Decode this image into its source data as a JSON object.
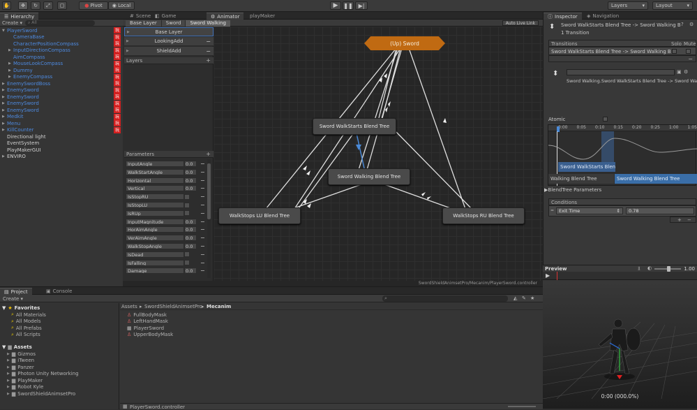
{
  "toolbar": {
    "pivot": "Pivot",
    "local": "Local",
    "layers": "Layers",
    "layout": "Layout"
  },
  "hierarchy": {
    "tab": "Hierarchy",
    "create": "Create",
    "search_placeholder": "All",
    "items": [
      {
        "label": "PlayerSword",
        "depth": 0,
        "color": "blue",
        "arrow": "▼",
        "tag": true
      },
      {
        "label": "CameraBase",
        "depth": 1,
        "color": "blue",
        "arrow": "",
        "tag": true
      },
      {
        "label": "CharacterPositionCompass",
        "depth": 1,
        "color": "blue",
        "arrow": "",
        "tag": true
      },
      {
        "label": "InputDirectionCompass",
        "depth": 1,
        "color": "blue",
        "arrow": "▶",
        "tag": true
      },
      {
        "label": "AimCompass",
        "depth": 1,
        "color": "blue",
        "arrow": "",
        "tag": true
      },
      {
        "label": "MouseLookCompass",
        "depth": 1,
        "color": "blue",
        "arrow": "▶",
        "tag": true
      },
      {
        "label": "Dummy",
        "depth": 1,
        "color": "blue",
        "arrow": "▶",
        "tag": true
      },
      {
        "label": "EnemyCompass",
        "depth": 1,
        "color": "blue",
        "arrow": "▶",
        "tag": true
      },
      {
        "label": "EnemySwordBoss",
        "depth": 0,
        "color": "blue",
        "arrow": "▶",
        "tag": true
      },
      {
        "label": "EnemySword",
        "depth": 0,
        "color": "blue",
        "arrow": "▶",
        "tag": true
      },
      {
        "label": "EnemySword",
        "depth": 0,
        "color": "blue",
        "arrow": "▶",
        "tag": true
      },
      {
        "label": "EnemySword",
        "depth": 0,
        "color": "blue",
        "arrow": "▶",
        "tag": true
      },
      {
        "label": "EnemySword",
        "depth": 0,
        "color": "blue",
        "arrow": "▶",
        "tag": true
      },
      {
        "label": "Medkit",
        "depth": 0,
        "color": "blue",
        "arrow": "▶",
        "tag": true
      },
      {
        "label": "Menu",
        "depth": 0,
        "color": "blue",
        "arrow": "▶",
        "tag": true
      },
      {
        "label": "KillCounter",
        "depth": 0,
        "color": "blue",
        "arrow": "▶",
        "tag": true
      },
      {
        "label": "Directional light",
        "depth": 0,
        "color": "white",
        "arrow": "",
        "tag": false
      },
      {
        "label": "EventSystem",
        "depth": 0,
        "color": "white",
        "arrow": "",
        "tag": false
      },
      {
        "label": "PlayMakerGUI",
        "depth": 0,
        "color": "white",
        "arrow": "",
        "tag": false
      },
      {
        "label": "ENVIRO",
        "depth": 0,
        "color": "white",
        "arrow": "▶",
        "tag": false
      }
    ],
    "tag_glyph": "玩"
  },
  "center_tabs": {
    "scene": "Scene",
    "game": "Game",
    "animator": "Animator",
    "playmaker": "playMaker"
  },
  "animator": {
    "breadcrumb": [
      "Base Layer",
      "Sword",
      "Sword Walking"
    ],
    "auto_live_link": "Auto Live Link",
    "layers": [
      "Base Layer",
      "LookingAdd",
      "ShieldAdd"
    ],
    "layers_label": "Layers",
    "parameters_label": "Parameters",
    "parameters": [
      {
        "name": "InputAngle",
        "type": "float",
        "value": "0.0"
      },
      {
        "name": "WalkStartAngle",
        "type": "float",
        "value": "0.0"
      },
      {
        "name": "Horizontal",
        "type": "float",
        "value": "0.0"
      },
      {
        "name": "Vertical",
        "type": "float",
        "value": "0.0"
      },
      {
        "name": "IsStopRU",
        "type": "bool",
        "value": ""
      },
      {
        "name": "IsStopLU",
        "type": "bool",
        "value": ""
      },
      {
        "name": "IsRUp",
        "type": "bool",
        "value": ""
      },
      {
        "name": "InputMagnitude",
        "type": "float",
        "value": "0.0"
      },
      {
        "name": "HorAimAngle",
        "type": "float",
        "value": "0.0"
      },
      {
        "name": "VerAimAngle",
        "type": "float",
        "value": "0.0"
      },
      {
        "name": "WalkStopAngle",
        "type": "float",
        "value": "0.0"
      },
      {
        "name": "IsDead",
        "type": "bool",
        "value": ""
      },
      {
        "name": "IsFalling",
        "type": "bool",
        "value": ""
      },
      {
        "name": "Damage",
        "type": "float",
        "value": "0.0"
      }
    ],
    "nodes": {
      "up": "(Up) Sword",
      "walkstarts": "Sword WalkStarts Blend Tree",
      "walking": "Sword Walking Blend Tree",
      "stopslu": "WalkStops LU Blend Tree",
      "stopsru": "WalkStops RU Blend Tree"
    },
    "path": "SwordShieldAnimsetPro/Mecanim/PlayerSword.controller"
  },
  "inspector": {
    "tab": "Inspector",
    "nav_tab": "Navigation",
    "title": "Sword WalkStarts Blend Tree -> Sword Walking B",
    "transitions_count": "1 Transition",
    "transitions_label": "Transitions",
    "solo": "Solo",
    "mute": "Mute",
    "transition_item": "Sword WalkStarts Blend Tree -> Sword Walking B",
    "sub_title": "Sword Walking.Sword WalkStarts Blend Tree -> Sword Walking",
    "atomic": "Atomic",
    "timeline_ticks": [
      "0:00",
      "0:05",
      "0:10",
      "0:15",
      "0:20",
      "0:25",
      "1:00",
      "1:05"
    ],
    "bar_from": "Sword WalkStarts Blend",
    "bar_to_left": "Walking Blend Tree",
    "bar_to_right": "Sword Walking Blend Tree",
    "blend_params": "BlendTree Parameters",
    "conditions": "Conditions",
    "condition_name": "Exit Time",
    "condition_value": "0.78",
    "preview": "Preview",
    "preview_speed": "1.00",
    "preview_time": "0:00 (000.0%)"
  },
  "project": {
    "tab": "Project",
    "console_tab": "Console",
    "create": "Create",
    "favorites_label": "Favorites",
    "favorites": [
      "All Materials",
      "All Models",
      "All Prefabs",
      "All Scripts"
    ],
    "assets_label": "Assets",
    "folders": [
      "Gizmos",
      "iTween",
      "Panzer",
      "Photon Unity Networking",
      "PlayMaker",
      "Robot Kyle",
      "SwordShieldAnimsetPro"
    ],
    "breadcrumb": [
      "Assets",
      "SwordShieldAnimsetPro",
      "Mecanim"
    ],
    "files": [
      "FullBodyMask",
      "LeftHandMask",
      "PlayerSword",
      "UpperBodyMask"
    ],
    "footer": "PlayerSword.controller"
  }
}
